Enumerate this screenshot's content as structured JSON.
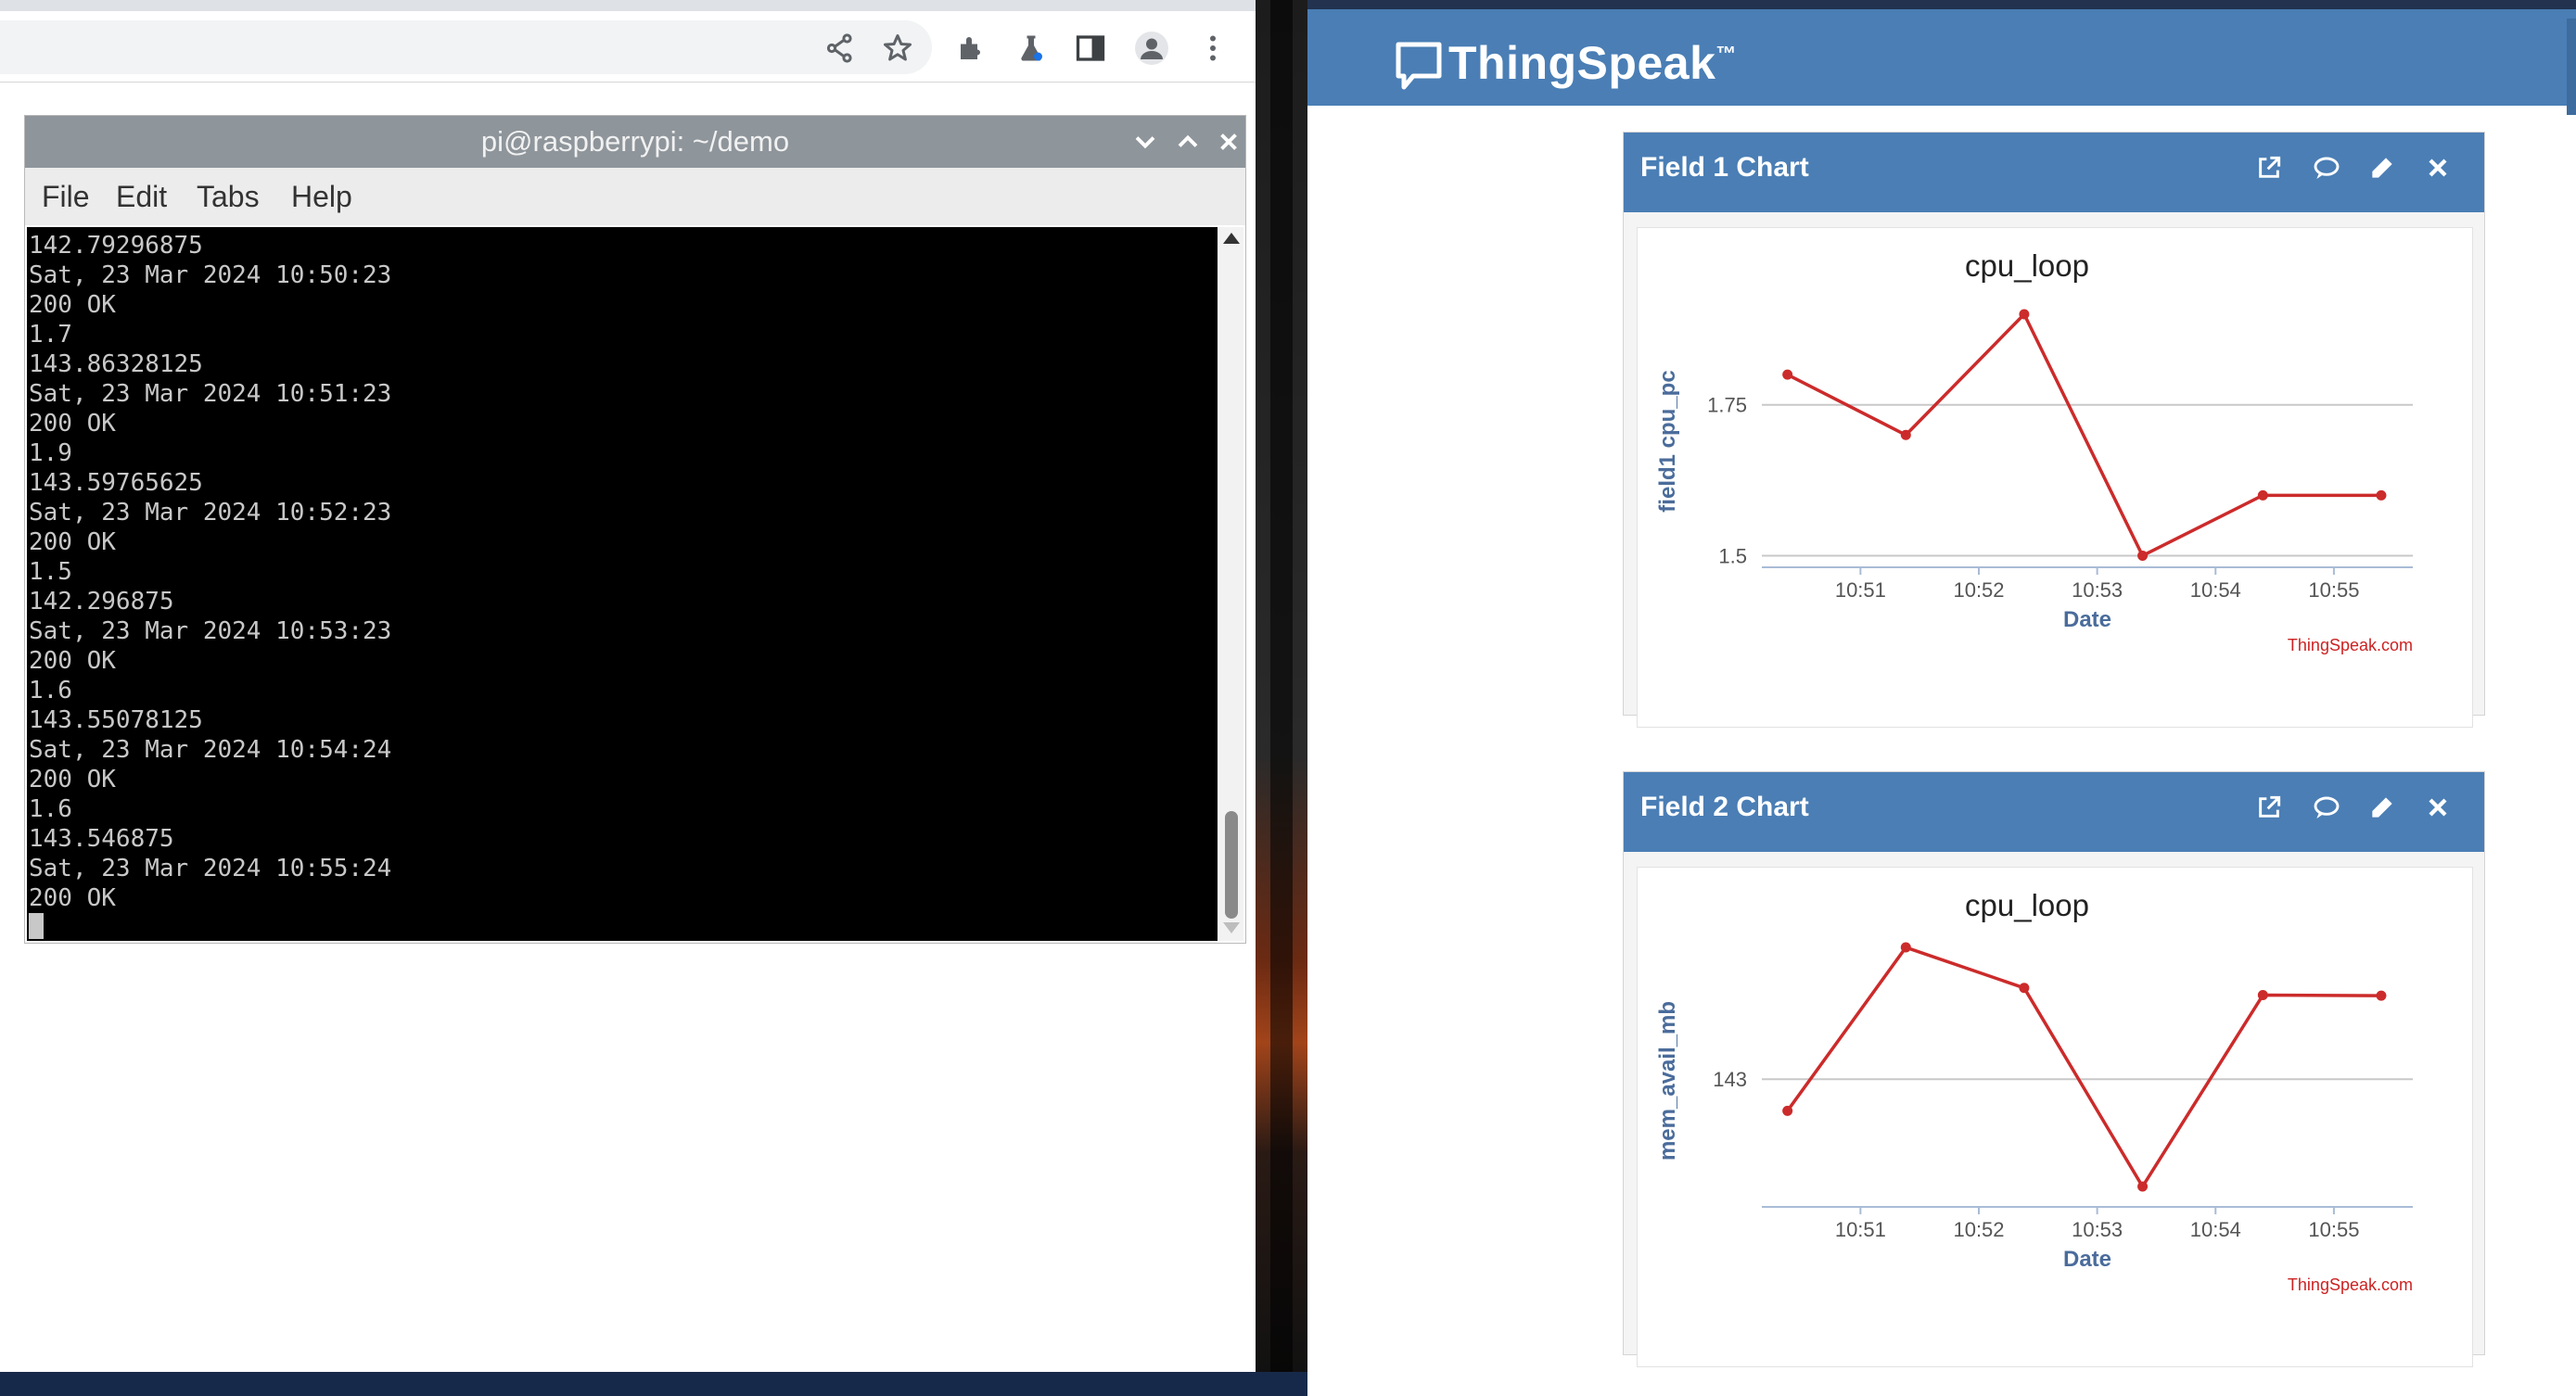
{
  "terminal": {
    "title": "pi@raspberrypi: ~/demo",
    "menu": [
      "File",
      "Edit",
      "Tabs",
      "Help"
    ],
    "lines": [
      "142.79296875",
      "Sat, 23 Mar 2024 10:50:23",
      "200 OK",
      "1.7",
      "143.86328125",
      "Sat, 23 Mar 2024 10:51:23",
      "200 OK",
      "1.9",
      "143.59765625",
      "Sat, 23 Mar 2024 10:52:23",
      "200 OK",
      "1.5",
      "142.296875",
      "Sat, 23 Mar 2024 10:53:23",
      "200 OK",
      "1.6",
      "143.55078125",
      "Sat, 23 Mar 2024 10:54:24",
      "200 OK",
      "1.6",
      "143.546875",
      "Sat, 23 Mar 2024 10:55:24",
      "200 OK"
    ]
  },
  "browser": {
    "toolbar_icons": [
      "share-icon",
      "star-icon",
      "extensions-icon",
      "labs-flask-icon",
      "side-panel-icon",
      "profile-icon",
      "more-vert-icon"
    ]
  },
  "thingspeak": {
    "brand": "ThingSpeak",
    "trademark": "™",
    "brand_color": "#4a7eb5",
    "panel_icons": [
      "open-external-icon",
      "comment-icon",
      "edit-pencil-icon",
      "close-icon"
    ],
    "panels": [
      {
        "title": "Field 1 Chart"
      },
      {
        "title": "Field 2 Chart"
      }
    ]
  },
  "chart_data": [
    {
      "type": "line",
      "title": "cpu_loop",
      "xlabel": "Date",
      "ylabel": "field1 cpu_pc",
      "credit": "ThingSpeak.com",
      "x": [
        "10:50:23",
        "10:51:23",
        "10:52:23",
        "10:53:23",
        "10:54:24",
        "10:55:24"
      ],
      "values": [
        1.8,
        1.7,
        1.9,
        1.5,
        1.6,
        1.6
      ],
      "ylim": [
        1.49,
        1.92
      ],
      "yticks": [
        1.5,
        1.75
      ],
      "ytick_labels": [
        "1.5",
        "1.75"
      ],
      "xticks": [
        "10:51",
        "10:52",
        "10:53",
        "10:54",
        "10:55"
      ],
      "line_color": "#cc2b2b",
      "grid": true
    },
    {
      "type": "line",
      "title": "cpu_loop",
      "xlabel": "Date",
      "ylabel": "mem_avail_mb",
      "credit": "ThingSpeak.com",
      "x": [
        "10:50:23",
        "10:51:23",
        "10:52:23",
        "10:53:23",
        "10:54:24",
        "10:55:24"
      ],
      "values": [
        142.79296875,
        143.86328125,
        143.59765625,
        142.296875,
        143.55078125,
        143.546875
      ],
      "ylim": [
        142.2,
        143.9
      ],
      "yticks": [
        143
      ],
      "ytick_labels": [
        "143"
      ],
      "xticks": [
        "10:51",
        "10:52",
        "10:53",
        "10:54",
        "10:55"
      ],
      "line_color": "#cc2b2b",
      "grid": true
    }
  ]
}
